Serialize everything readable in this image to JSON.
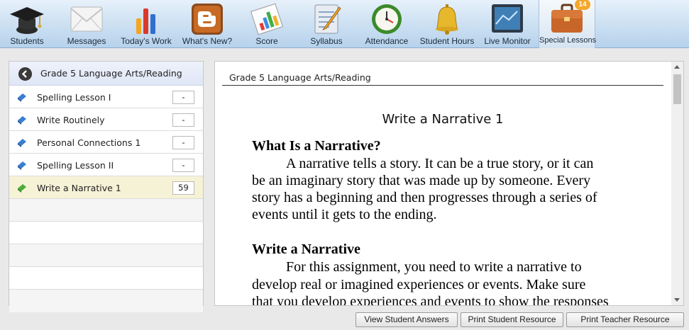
{
  "toolbar": {
    "items": [
      {
        "label": "Students",
        "icon": "graduation-cap-icon"
      },
      {
        "label": "Messages",
        "icon": "envelope-icon"
      },
      {
        "label": "Today's Work",
        "icon": "bar-chart-icon"
      },
      {
        "label": "What's New?",
        "icon": "blogger-icon"
      },
      {
        "label": "Score",
        "icon": "score-chart-icon"
      },
      {
        "label": "Syllabus",
        "icon": "notepad-icon"
      },
      {
        "label": "Attendance",
        "icon": "clock-icon"
      },
      {
        "label": "Student Hours",
        "icon": "bell-icon"
      },
      {
        "label": "Live Monitor",
        "icon": "monitor-icon"
      },
      {
        "label": "Special Lessons",
        "icon": "briefcase-icon",
        "badge": "14"
      }
    ]
  },
  "lessons": {
    "course_title": "Grade 5 Language Arts/Reading",
    "items": [
      {
        "name": "Spelling Lesson I",
        "score": "-"
      },
      {
        "name": "Write Routinely",
        "score": "-"
      },
      {
        "name": "Personal Connections 1",
        "score": "-"
      },
      {
        "name": "Spelling Lesson II",
        "score": "-"
      },
      {
        "name": "Write a Narrative 1",
        "score": "59",
        "selected": true
      }
    ]
  },
  "document": {
    "header": "Grade 5 Language Arts/Reading",
    "title": "Write a Narrative 1",
    "section1_heading": "What Is a Narrative?",
    "section1_lines": [
      "A narrative tells a story.  It can be a true story, or it can",
      "be an imaginary story that was made up by someone.  Every",
      "story has a beginning and then progresses through a series of",
      "events until it gets to the ending."
    ],
    "section2_heading": "Write a Narrative",
    "section2_lines": [
      "For this assignment, you need to write a narrative to",
      "develop real or imagined experiences or events.  Make sure",
      "that you develop experiences and events to show the responses"
    ]
  },
  "buttons": {
    "view_answers": "View Student Answers",
    "print_student": "Print Student Resource",
    "print_teacher": "Print Teacher Resource"
  },
  "colors": {
    "toolbar_bg": "#c8def2",
    "selected_row": "#f6f2d6",
    "badge": "#f4a72a"
  }
}
